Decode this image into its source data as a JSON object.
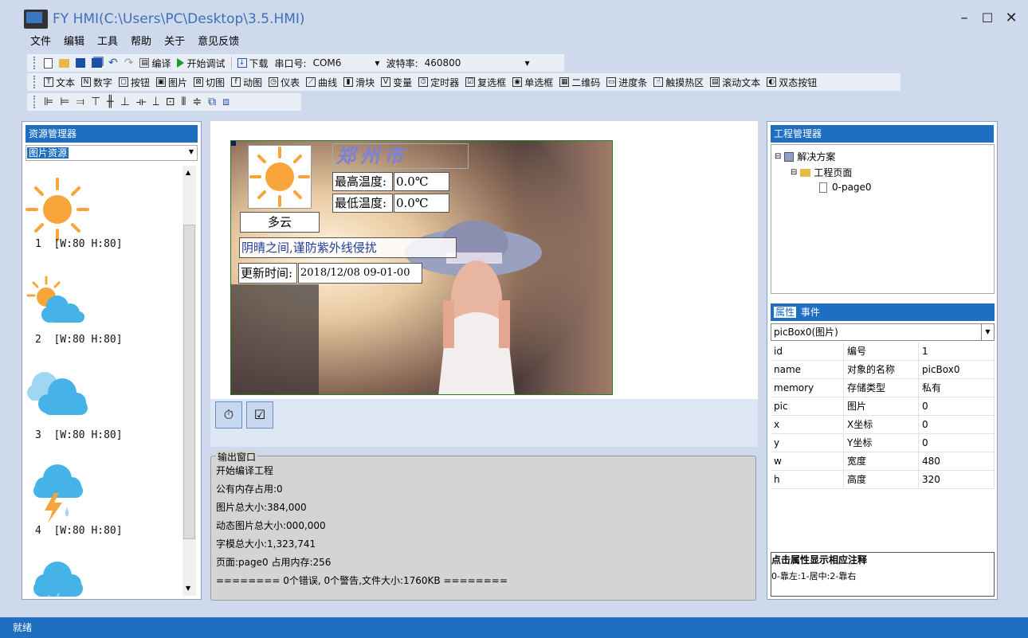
{
  "window": {
    "title": "FY HMI(C:\\Users\\PC\\Desktop\\3.5.HMI)",
    "min": "–",
    "max": "☐",
    "close": "✕"
  },
  "menu": [
    "文件",
    "编辑",
    "工具",
    "帮助",
    "关于",
    "意见反馈"
  ],
  "toolbar1": {
    "compile": "编译",
    "debug": "开始调试",
    "download": "下载",
    "port_label": "串口号:",
    "port_value": "COM6",
    "baud_label": "波特率:",
    "baud_value": "460800"
  },
  "toolbar2": [
    {
      "icon": "T",
      "label": "文本"
    },
    {
      "icon": "N",
      "label": "数字"
    },
    {
      "icon": "◻",
      "label": "按钮"
    },
    {
      "icon": "▣",
      "label": "图片"
    },
    {
      "icon": "⊠",
      "label": "切图"
    },
    {
      "icon": "f",
      "label": "动图"
    },
    {
      "icon": "◷",
      "label": "仪表"
    },
    {
      "icon": "⟋",
      "label": "曲线"
    },
    {
      "icon": "▮",
      "label": "滑块"
    },
    {
      "icon": "V",
      "label": "变量"
    },
    {
      "icon": "⏱",
      "label": "定时器"
    },
    {
      "icon": "☑",
      "label": "复选框"
    },
    {
      "icon": "◉",
      "label": "单选框"
    },
    {
      "icon": "▦",
      "label": "二维码"
    },
    {
      "icon": "▭",
      "label": "进度条"
    },
    {
      "icon": "☝",
      "label": "触摸热区"
    },
    {
      "icon": "▤",
      "label": "滚动文本"
    },
    {
      "icon": "◐",
      "label": "双态按钮"
    }
  ],
  "toolbar3_icons": [
    "align-left-icon",
    "align-hcenter-icon",
    "align-right-icon",
    "align-top-icon",
    "align-vcenter-icon",
    "align-bottom-icon",
    "distribute-h-icon",
    "distribute-v-icon",
    "same-size-icon",
    "same-width-icon",
    "same-height-icon",
    "bring-front-icon",
    "send-back-icon"
  ],
  "resource": {
    "title": "资源管理器",
    "dropdown": "图片资源",
    "images": [
      {
        "label": "1  [W:80 H:80]",
        "icon": "sun-icon"
      },
      {
        "label": "2  [W:80 H:80]",
        "icon": "partly-cloudy-icon"
      },
      {
        "label": "3  [W:80 H:80]",
        "icon": "cloudy-icon"
      },
      {
        "label": "4  [W:80 H:80]",
        "icon": "thunderstorm-icon"
      },
      {
        "label": "",
        "icon": "rain-icon"
      }
    ]
  },
  "canvas": {
    "city": "郑州市",
    "max_label": "最高温度:",
    "max_value": "0.0℃",
    "min_label": "最低温度:",
    "min_value": "0.0℃",
    "weather": "多云",
    "tip": "阴晴之间,谨防紫外线侵扰",
    "update_label": "更新时间:",
    "update_value": "2018/12/08 09-01-00"
  },
  "output": {
    "title": "输出窗口",
    "lines": [
      "开始编译工程",
      "公有内存占用:0",
      "图片总大小:384,000",
      "动态图片总大小:000,000",
      "字模总大小:1,323,741",
      "页面:page0 占用内存:256",
      "======== 0个错误, 0个警告,文件大小:1760KB ========"
    ]
  },
  "project": {
    "title": "工程管理器",
    "solution": "解决方案",
    "pages": "工程页面",
    "page0": "0-page0"
  },
  "props": {
    "tab_props": "属性",
    "tab_events": "事件",
    "selected": "picBox0(图片)",
    "rows": [
      [
        "id",
        "编号",
        "1"
      ],
      [
        "name",
        "对象的名称",
        "picBox0"
      ],
      [
        "memory",
        "存储类型",
        "私有"
      ],
      [
        "pic",
        "图片",
        "0"
      ],
      [
        "x",
        "X坐标",
        "0"
      ],
      [
        "y",
        "Y坐标",
        "0"
      ],
      [
        "w",
        "宽度",
        "480"
      ],
      [
        "h",
        "高度",
        "320"
      ]
    ],
    "hint_title": "点击属性显示相应注释",
    "hint_text": "0-靠左:1-居中:2-靠右"
  },
  "status": "就绪",
  "colors": {
    "accent": "#1e6ec2",
    "sun": "#f7a53a",
    "cloud": "#45b3e8"
  }
}
